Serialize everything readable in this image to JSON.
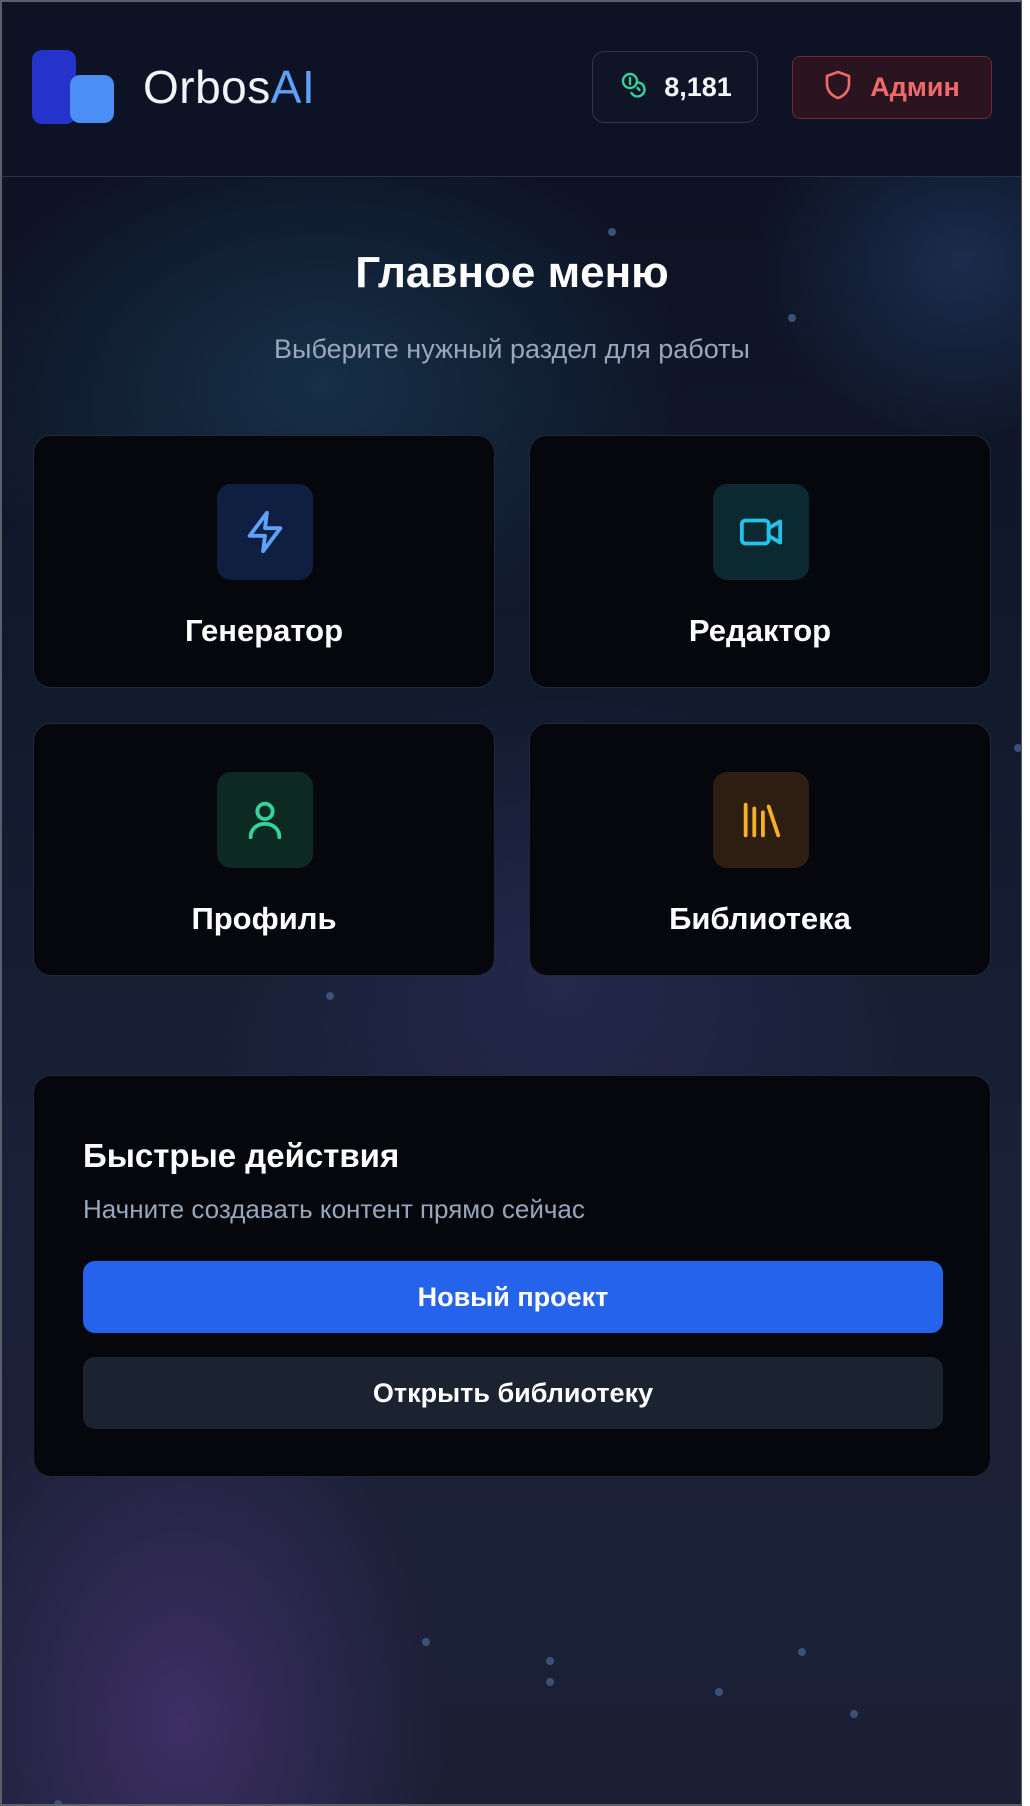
{
  "header": {
    "brand_main": "Orbos",
    "brand_accent": "AI",
    "credits": "8,181",
    "admin_label": "Админ"
  },
  "main": {
    "title": "Главное меню",
    "subtitle": "Выберите нужный раздел для работы",
    "cards": [
      {
        "label": "Генератор",
        "icon": "lightning-icon",
        "color": "#5ea2f7"
      },
      {
        "label": "Редактор",
        "icon": "video-camera-icon",
        "color": "#22c3e6"
      },
      {
        "label": "Профиль",
        "icon": "user-icon",
        "color": "#34d399"
      },
      {
        "label": "Библиотека",
        "icon": "library-icon",
        "color": "#f5b025"
      }
    ]
  },
  "quick_actions": {
    "title": "Быстрые действия",
    "subtitle": "Начните создавать контент прямо сейчас",
    "primary_button": "Новый проект",
    "secondary_button": "Открыть библиотеку"
  },
  "colors": {
    "accent": "#2563eb",
    "brand_accent": "#5ea2f7",
    "admin": "#f06a6a"
  }
}
